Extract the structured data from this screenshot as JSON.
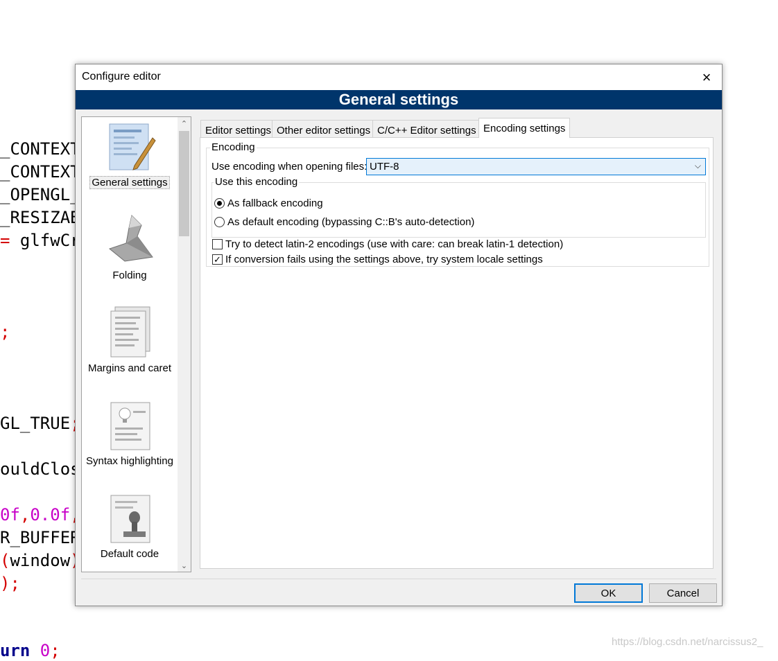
{
  "background_code": {
    "lines": [
      {
        "segments": [
          {
            "text": "_CONTEXT",
            "color": "black"
          }
        ]
      },
      {
        "segments": [
          {
            "text": "_CONTEXT",
            "color": "black"
          }
        ]
      },
      {
        "segments": [
          {
            "text": "_OPENGL_",
            "color": "black"
          }
        ]
      },
      {
        "segments": [
          {
            "text": "_RESIZAB",
            "color": "black"
          }
        ]
      },
      {
        "segments": [
          {
            "text": "= ",
            "color": "red"
          },
          {
            "text": "glfwCr",
            "color": "black"
          }
        ]
      },
      {
        "segments": [
          {
            "text": ";",
            "color": "red"
          }
        ]
      },
      {
        "segments": [
          {
            "text": "GL_TRUE",
            "color": "black"
          },
          {
            "text": ";",
            "color": "red"
          }
        ]
      },
      {
        "segments": [
          {
            "text": "ouldClos",
            "color": "black"
          }
        ]
      },
      {
        "segments": [
          {
            "text": "0f",
            "color": "magenta"
          },
          {
            "text": ",",
            "color": "red"
          },
          {
            "text": "0.0f",
            "color": "magenta"
          },
          {
            "text": ",",
            "color": "red"
          }
        ]
      },
      {
        "segments": [
          {
            "text": "R_BUFFER",
            "color": "black"
          }
        ]
      },
      {
        "segments": [
          {
            "text": "(",
            "color": "red"
          },
          {
            "text": "window",
            "color": "black"
          },
          {
            "text": ")",
            "color": "red"
          }
        ]
      },
      {
        "segments": [
          {
            "text": ");",
            "color": "red"
          }
        ]
      },
      {
        "segments": [
          {
            "text": "urn ",
            "color": "navy"
          },
          {
            "text": "0",
            "color": "magenta"
          },
          {
            "text": ";",
            "color": "red"
          }
        ]
      }
    ]
  },
  "watermark": "https://blog.csdn.net/narcissus2_",
  "dialog": {
    "title": "Configure editor",
    "close_icon": "×",
    "banner": "General settings",
    "nav": {
      "items": [
        {
          "label": "General settings",
          "icon": "pencil-document-icon",
          "selected": true
        },
        {
          "label": "Folding",
          "icon": "origami-bird-icon"
        },
        {
          "label": "Margins and caret",
          "icon": "pages-icon"
        },
        {
          "label": "Syntax highlighting",
          "icon": "lightbulb-document-icon"
        },
        {
          "label": "Default code",
          "icon": "stamp-icon"
        }
      ],
      "scroll_up": "⌃",
      "scroll_down": "⌄"
    },
    "tabs": [
      {
        "label": "Editor settings"
      },
      {
        "label": "Other editor settings"
      },
      {
        "label": "C/C++ Editor settings"
      },
      {
        "label": "Encoding settings",
        "active": true
      }
    ],
    "encoding": {
      "legend": "Encoding",
      "open_label": "Use encoding when opening files:",
      "selected": "UTF-8",
      "arrow": "⌵",
      "use_this": {
        "legend": "Use this encoding",
        "fallback": {
          "label": "As fallback encoding",
          "checked": true
        },
        "default": {
          "label": "As default encoding (bypassing C::B's auto-detection)",
          "checked": false
        }
      },
      "latin2": {
        "label": "Try to detect latin-2 encodings (use with care: can break latin-1 detection)",
        "checked": false
      },
      "locale": {
        "label": "If conversion fails using the settings above, try system locale settings",
        "checked": true,
        "mark": "✓"
      }
    },
    "buttons": {
      "ok": "OK",
      "cancel": "Cancel"
    }
  }
}
